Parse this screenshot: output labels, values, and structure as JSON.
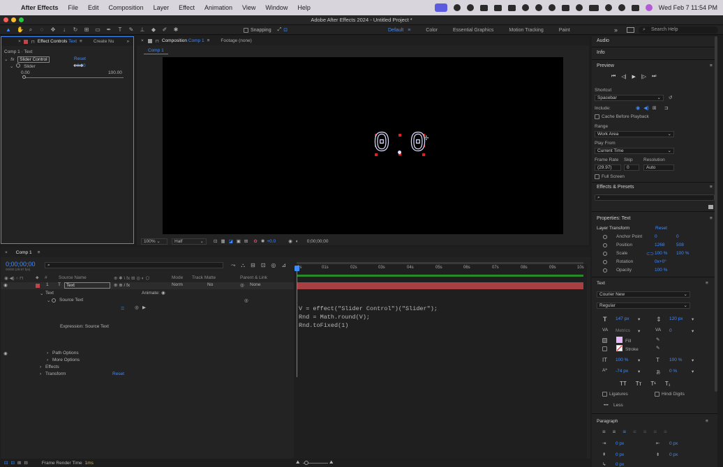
{
  "menubar": {
    "app_name": "After Effects",
    "items": [
      "File",
      "Edit",
      "Composition",
      "Layer",
      "Effect",
      "Animation",
      "View",
      "Window",
      "Help"
    ],
    "clock": "Wed Feb 7  11:54 PM"
  },
  "window": {
    "title": "Adobe After Effects 2024 - Untitled Project *"
  },
  "toolbar": {
    "snapping_label": "Snapping",
    "workspaces": [
      "Default",
      "Color",
      "Essential Graphics",
      "Motion Tracking",
      "Paint"
    ],
    "active_workspace": "Default",
    "search_placeholder": "Search Help"
  },
  "effect_controls": {
    "tab_label": "Effect Controls",
    "tab_layer": "Text",
    "other_tab": "Create Nu",
    "breadcrumb": "Comp 1 · Text",
    "effect_name": "Slider Control",
    "reset_label": "Reset",
    "param_name": "Slider",
    "param_value": "0.00",
    "range_min": "0.00",
    "range_max": "100.00",
    "slider_fraction": 0
  },
  "composition": {
    "tab_label": "Composition",
    "tab_comp": "Comp 1",
    "footage_tab": "Footage (none)",
    "sub_tab": "Comp 1",
    "display_text": "0.0",
    "digit_left": "0",
    "digit_right": "0",
    "zoom": "100%",
    "resolution": "Half",
    "exposure": "+0.0",
    "timecode": "0;00;00;00"
  },
  "right_panel": {
    "audio": "Audio",
    "info": "Info",
    "preview": "Preview",
    "shortcut_label": "Shortcut",
    "shortcut_value": "Spacebar",
    "include_label": "Include:",
    "cache_label": "Cache Before Playback",
    "range_label": "Range",
    "range_value": "Work Area",
    "play_from_label": "Play From",
    "play_from_value": "Current Time",
    "frame_rate_label": "Frame Rate",
    "skip_label": "Skip",
    "resolution_label": "Resolution",
    "frame_rate_value": "(29.97)",
    "skip_value": "0",
    "resolution_value": "Auto",
    "full_screen_label": "Full Screen",
    "effects_presets": "Effects & Presets",
    "properties_title": "Properties: Text",
    "layer_transform": "Layer Transform",
    "reset_label": "Reset",
    "transform": [
      {
        "name": "Anchor Point",
        "v1": "0",
        "v2": "0"
      },
      {
        "name": "Position",
        "v1": "1268",
        "v2": "508"
      },
      {
        "name": "Scale",
        "v1": "100 %",
        "v2": "100 %"
      },
      {
        "name": "Rotation",
        "v1": "0x+0°",
        "v2": ""
      },
      {
        "name": "Opacity",
        "v1": "100 %",
        "v2": ""
      }
    ],
    "text_section": "Text",
    "font": "Courier New",
    "font_style": "Regular",
    "font_size": "147 px",
    "leading": "120 px",
    "kerning": "Metrics",
    "tracking": "0",
    "fill_label": "Fill",
    "stroke_label": "Stroke",
    "vscale": "100 %",
    "hscale": "100 %",
    "baseline": "-74 px",
    "tsume": "0 %",
    "ligatures_label": "Ligatures",
    "hindi_label": "Hindi Digits",
    "less_label": "Less",
    "paragraph": "Paragraph",
    "indent_values": [
      "0 px",
      "0 px",
      "0 px",
      "0 px",
      "0 px"
    ]
  },
  "timeline": {
    "tab_label": "Comp 1",
    "timecode": "0;00;00;00",
    "fps_note": "00000 (29.97 fps)",
    "col_source_name": "Source Name",
    "col_mode": "Mode",
    "col_track_matte": "Track Matte",
    "col_parent": "Parent & Link",
    "layer_number": "1",
    "layer_name": "Text",
    "layer_mode": "Norm",
    "layer_matte": "No",
    "layer_parent": "None",
    "text_group": "Text",
    "animate_label": "Animate:",
    "source_text": "Source Text",
    "expression_label": "Expression: Source Text",
    "path_options": "Path Options",
    "more_options": "More Options",
    "effects": "Effects",
    "transform": "Transform",
    "reset_label": "Reset",
    "ruler_ticks": [
      "0s",
      "01s",
      "02s",
      "03s",
      "04s",
      "05s",
      "06s",
      "07s",
      "08s",
      "09s",
      "10s"
    ],
    "expression_lines": [
      "V = effect(\"Slider Control\")(\"Slider\");",
      "Rnd = Math.round(V);",
      "Rnd.toFixed(1)"
    ]
  },
  "status": {
    "frame_render_label": "Frame Render Time",
    "frame_render_value": "1ms"
  },
  "colors": {
    "accent": "#3f8cff",
    "layer_bar": "#c0454a",
    "handle": "#e02020"
  }
}
